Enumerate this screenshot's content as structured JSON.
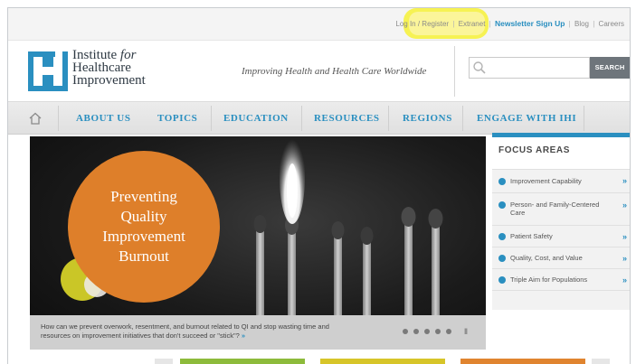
{
  "utility": {
    "login_register": "Log In / Register",
    "extranet": "Extranet",
    "newsletter": "Newsletter Sign Up",
    "blog": "Blog",
    "careers": "Careers",
    "separator": "|"
  },
  "header": {
    "logo_line1": "Institute ",
    "logo_line1_em": "for",
    "logo_line2": "Healthcare",
    "logo_line3": "Improvement",
    "tagline": "Improving Health and Health Care Worldwide",
    "search_placeholder": "",
    "search_button": "SEARCH"
  },
  "nav": {
    "items": [
      "ABOUT US",
      "TOPICS",
      "EDUCATION",
      "RESOURCES",
      "REGIONS",
      "ENGAGE WITH IHI"
    ]
  },
  "hero": {
    "title_lines": [
      "Preventing",
      "Quality",
      "Improvement",
      "Burnout"
    ],
    "caption": "How can we prevent overwork, resentment, and burnout related to QI and stop wasting time and resources on improvement initiatives that don't succeed or \"stick\"?",
    "caption_arrow": "»",
    "pause_icon": "II"
  },
  "focus": {
    "title": "FOCUS AREAS",
    "items": [
      "Improvement Capability",
      "Person- and Family-Centered Care",
      "Patient Safety",
      "Quality, Cost, and Value",
      "Triple Aim for Populations"
    ],
    "arrow": "»"
  },
  "colors": {
    "brand_blue": "#2a8fc0",
    "orange": "#de7f2a",
    "highlight_yellow": "#f6f14a",
    "tile_green": "#8dbb3b",
    "tile_yellow": "#d7c529",
    "tile_orange": "#e0842f"
  }
}
